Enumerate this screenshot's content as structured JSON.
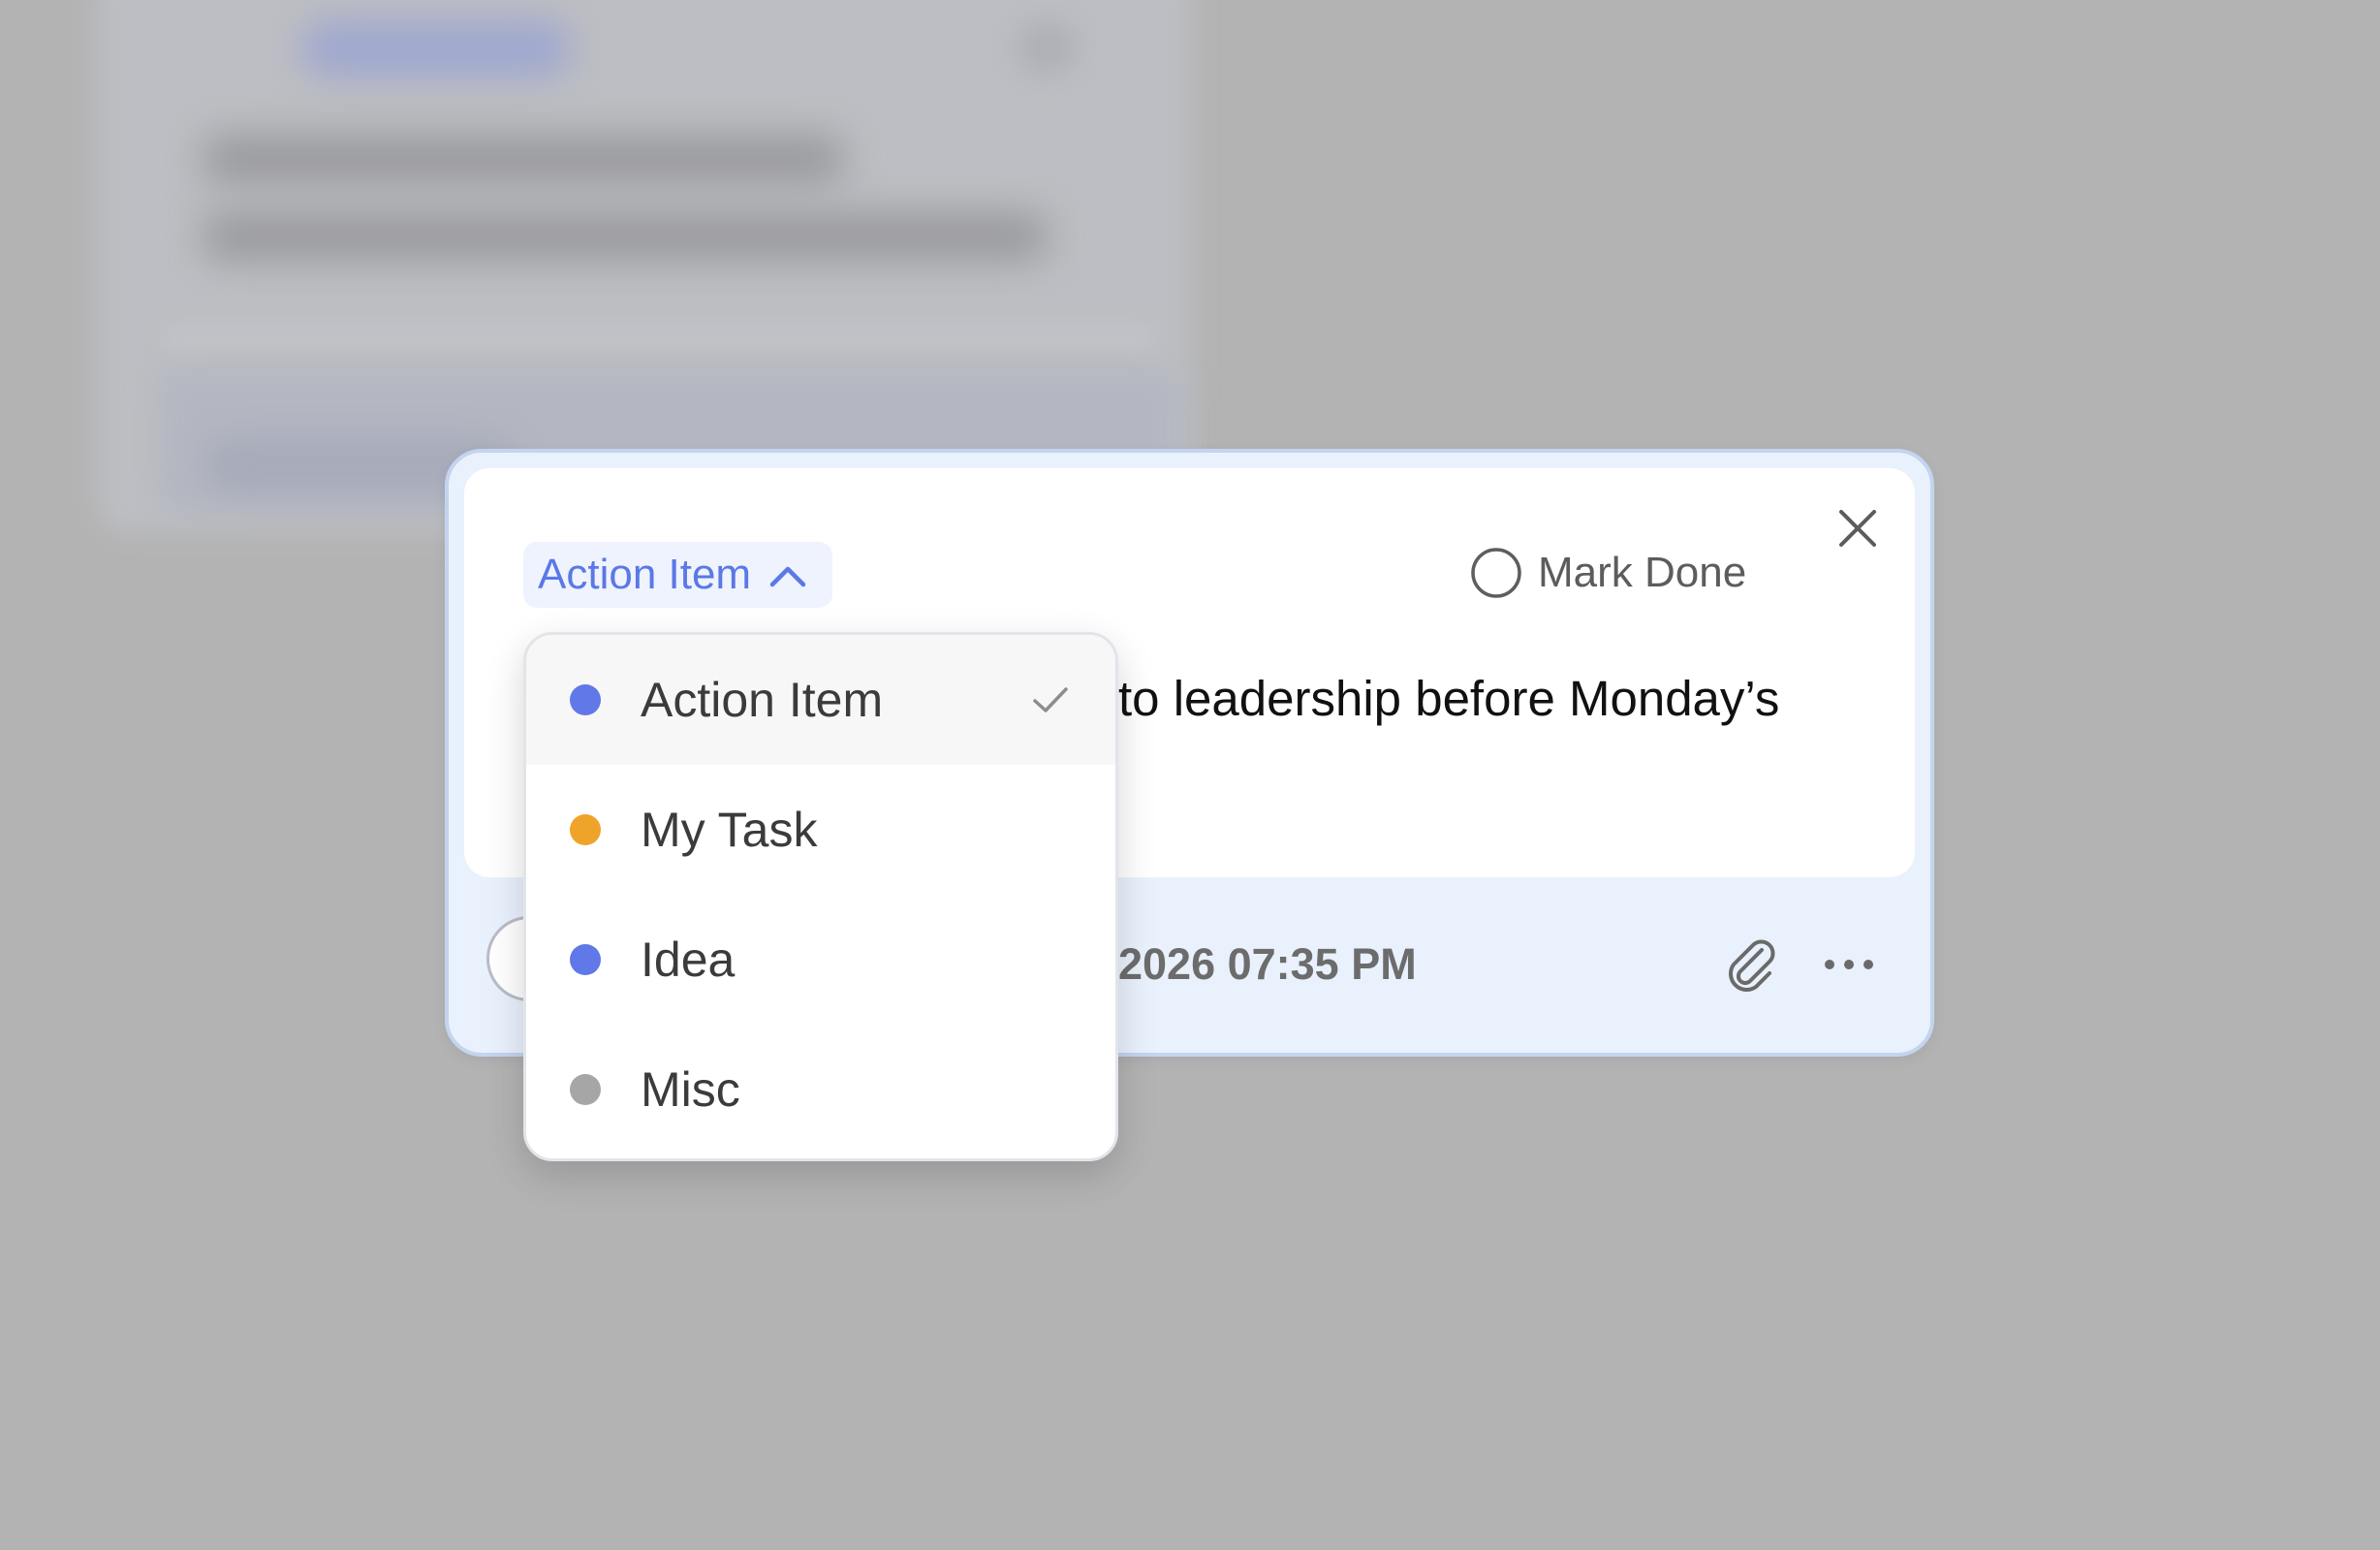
{
  "note_card": {
    "type_selector": {
      "label": "Action Item"
    },
    "mark_done": {
      "label": "Mark Done"
    },
    "body_text": "to leadership before Monday’s",
    "footer": {
      "date_text": "2026 07:35 PM"
    }
  },
  "type_menu": {
    "items": [
      {
        "label": "Action Item",
        "color": "#6078e8",
        "selected": true
      },
      {
        "label": "My Task",
        "color": "#f0a32a",
        "selected": false
      },
      {
        "label": "Idea",
        "color": "#6078e8",
        "selected": false
      },
      {
        "label": "Misc",
        "color": "#a6a6a6",
        "selected": false
      }
    ]
  },
  "colors": {
    "accent": "#5b78e6",
    "modal_bg": "#e9f1fd",
    "overlay": "#b3b3b3"
  },
  "icons": {
    "type_selector": "chevron-up-icon",
    "mark_done": "circle-outline-icon",
    "close": "close-icon",
    "attach": "paperclip-icon",
    "more": "more-horizontal-icon",
    "selected": "checkmark-icon"
  }
}
